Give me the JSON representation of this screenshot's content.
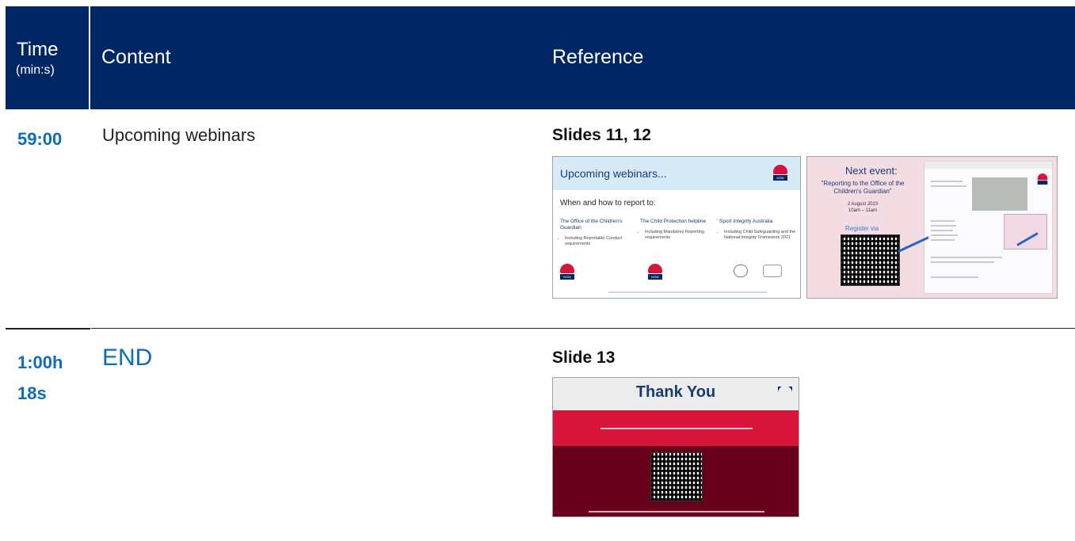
{
  "header": {
    "time_label": "Time",
    "time_sub": "(min:s)",
    "content_label": "Content",
    "reference_label": "Reference"
  },
  "rows": [
    {
      "time": "59:00",
      "content": "Upcoming webinars",
      "reference_title": "Slides 11, 12"
    },
    {
      "time_line1": "1:00h",
      "time_line2": "18s",
      "content": "END",
      "reference_title": "Slide 13"
    }
  ],
  "slide11": {
    "title": "Upcoming webinars...",
    "subtitle": "When and how to report to:",
    "columns": [
      {
        "heading": "The Office of the Children's Guardian",
        "bullet": "Including Reportable Conduct requirements"
      },
      {
        "heading": "The Child Protection helpline",
        "bullet": "Including Mandatory Reporting requirements"
      },
      {
        "heading": "Sport Integrity Australia",
        "bullet": "Including Child Safeguarding and the National Integrity Framework 2021"
      }
    ]
  },
  "slide12": {
    "heading": "Next event:",
    "event_title": "\"Reporting to the Office of the Children's Guardian\"",
    "date": "2 August 2023",
    "time": "10am – 11am",
    "register": "Register via"
  },
  "slide13": {
    "title": "Thank You"
  },
  "colors": {
    "header_bg": "#002664",
    "accent_blue": "#0a6cc2",
    "nsw_red": "#d7153a",
    "maroon": "#68001c"
  }
}
